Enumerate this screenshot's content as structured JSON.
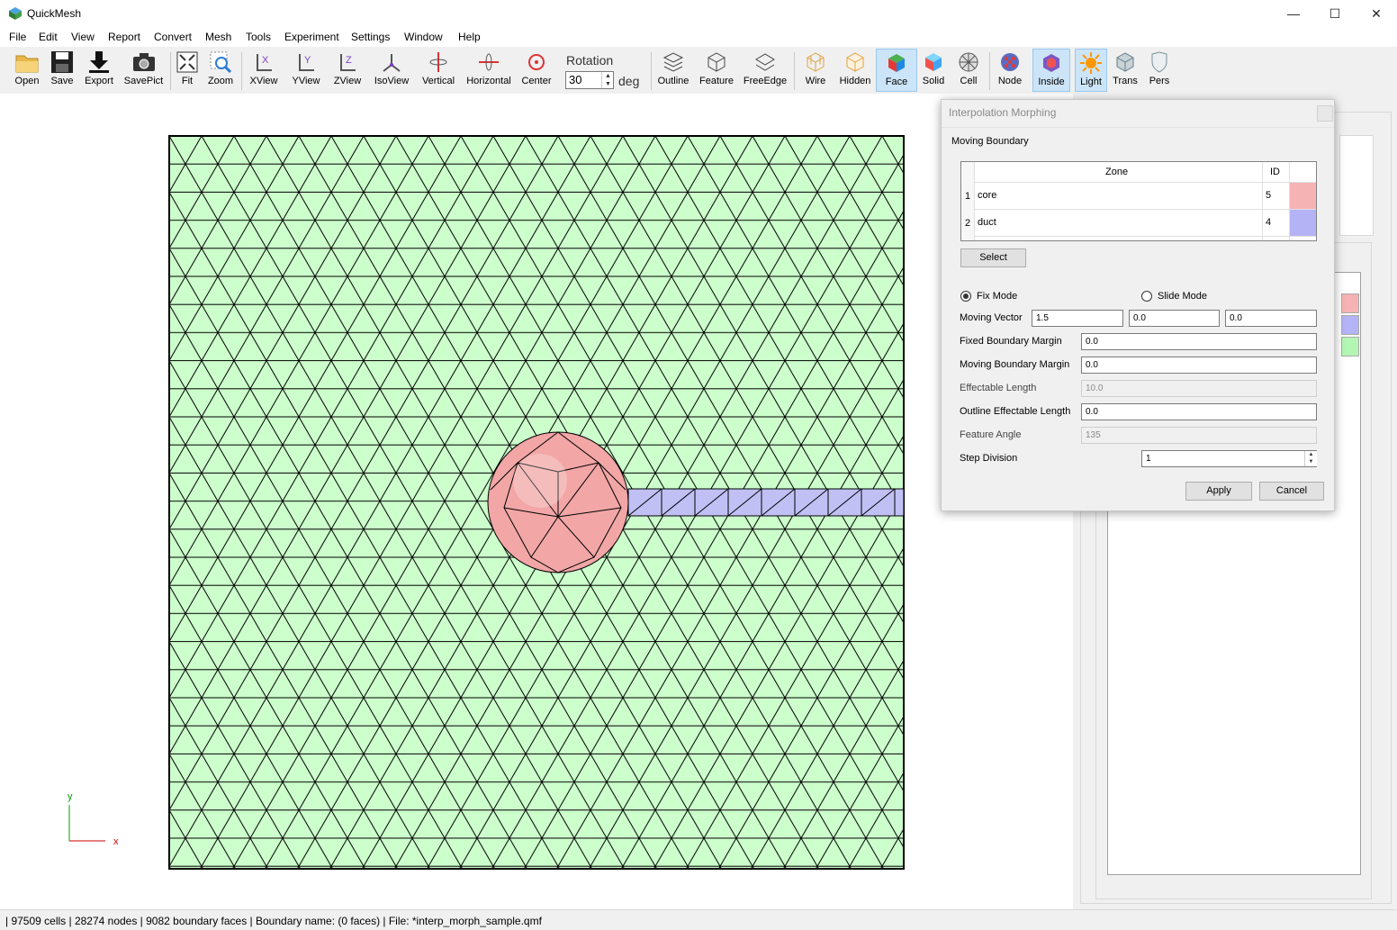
{
  "window": {
    "title": "QuickMesh",
    "controls": {
      "minimize": "—",
      "maximize": "☐",
      "close": "✕"
    }
  },
  "menu": [
    "File",
    "Edit",
    "View",
    "Report",
    "Convert",
    "Mesh",
    "Tools",
    "Experiment",
    "Settings",
    "Window",
    "Help"
  ],
  "toolbar": {
    "open": "Open",
    "save": "Save",
    "export": "Export",
    "savepict": "SavePict",
    "fit": "Fit",
    "zoom": "Zoom",
    "xview": "XView",
    "yview": "YView",
    "zview": "ZView",
    "isoview": "IsoView",
    "vertical": "Vertical",
    "horizontal": "Horizontal",
    "center": "Center",
    "rotation_label": "Rotation",
    "rotation_value": "30",
    "rotation_unit": "deg",
    "outline": "Outline",
    "feature": "Feature",
    "freeedge": "FreeEdge",
    "wire": "Wire",
    "hidden": "Hidden",
    "face": "Face",
    "solid": "Solid",
    "cell": "Cell",
    "node": "Node",
    "inside": "Inside",
    "light": "Light",
    "trans": "Trans",
    "pers": "Pers"
  },
  "axes": {
    "y": "y",
    "x": "x"
  },
  "colors": {
    "background_mesh": "#ccffcc",
    "core": "#f5b3b3",
    "duct": "#b3b3f5",
    "fluid": "#b3f5b3",
    "active_button": "#cce4f7"
  },
  "dialog": {
    "title": "Interpolation Morphing",
    "group_label": "Moving Boundary",
    "table": {
      "headers": {
        "zone": "Zone",
        "id": "ID"
      },
      "rows": [
        {
          "num": "1",
          "zone": "core",
          "id": "5",
          "color": "#f5b3b3"
        },
        {
          "num": "2",
          "zone": "duct",
          "id": "4",
          "color": "#b3b3f5"
        }
      ]
    },
    "select_button": "Select",
    "fix_mode": "Fix Mode",
    "slide_mode": "Slide Mode",
    "moving_vector_label": "Moving Vector",
    "moving_vector": [
      "1.5",
      "0.0",
      "0.0"
    ],
    "fixed_boundary_margin_label": "Fixed Boundary Margin",
    "fixed_boundary_margin": "0.0",
    "moving_boundary_margin_label": "Moving Boundary Margin",
    "moving_boundary_margin": "0.0",
    "effectable_length_label": "Effectable Length",
    "effectable_length": "10.0",
    "outline_effectable_length_label": "Outline Effectable Length",
    "outline_effectable_length": "0.0",
    "feature_angle_label": "Feature Angle",
    "feature_angle": "135",
    "step_division_label": "Step Division",
    "step_division": "1",
    "apply": "Apply",
    "cancel": "Cancel"
  },
  "status": " | 97509 cells | 28274 nodes | 9082 boundary faces |  Boundary name:  (0 faces) | File: *interp_morph_sample.qmf"
}
